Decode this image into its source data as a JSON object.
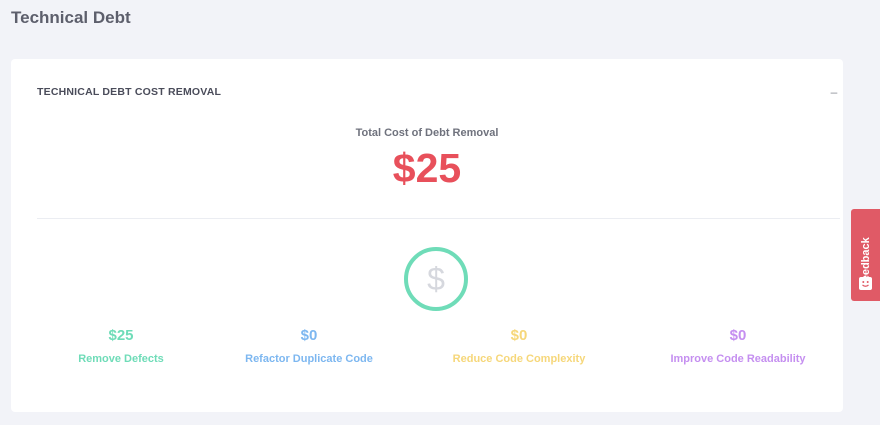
{
  "page": {
    "title": "Technical Debt"
  },
  "card": {
    "title": "TECHNICAL DEBT COST REMOVAL",
    "collapse_label": "–",
    "total_label": "Total Cost of Debt Removal",
    "total_value": "$25",
    "total_color": "#e8505b",
    "ring_color": "#6fdcb8",
    "ring_icon": "dollar-icon",
    "ring_symbol": "$"
  },
  "categories": [
    {
      "value": "$25",
      "label": "Remove Defects",
      "color": "#6fdcb8"
    },
    {
      "value": "$0",
      "label": "Refactor Duplicate Code",
      "color": "#7db7f0"
    },
    {
      "value": "$0",
      "label": "Reduce Code Complexity",
      "color": "#f6d77a"
    },
    {
      "value": "$0",
      "label": "Improve Code Readability",
      "color": "#c58ff0"
    }
  ],
  "feedback": {
    "label": "Feedback",
    "icon": "smiley-icon",
    "color": "#e05a66"
  }
}
